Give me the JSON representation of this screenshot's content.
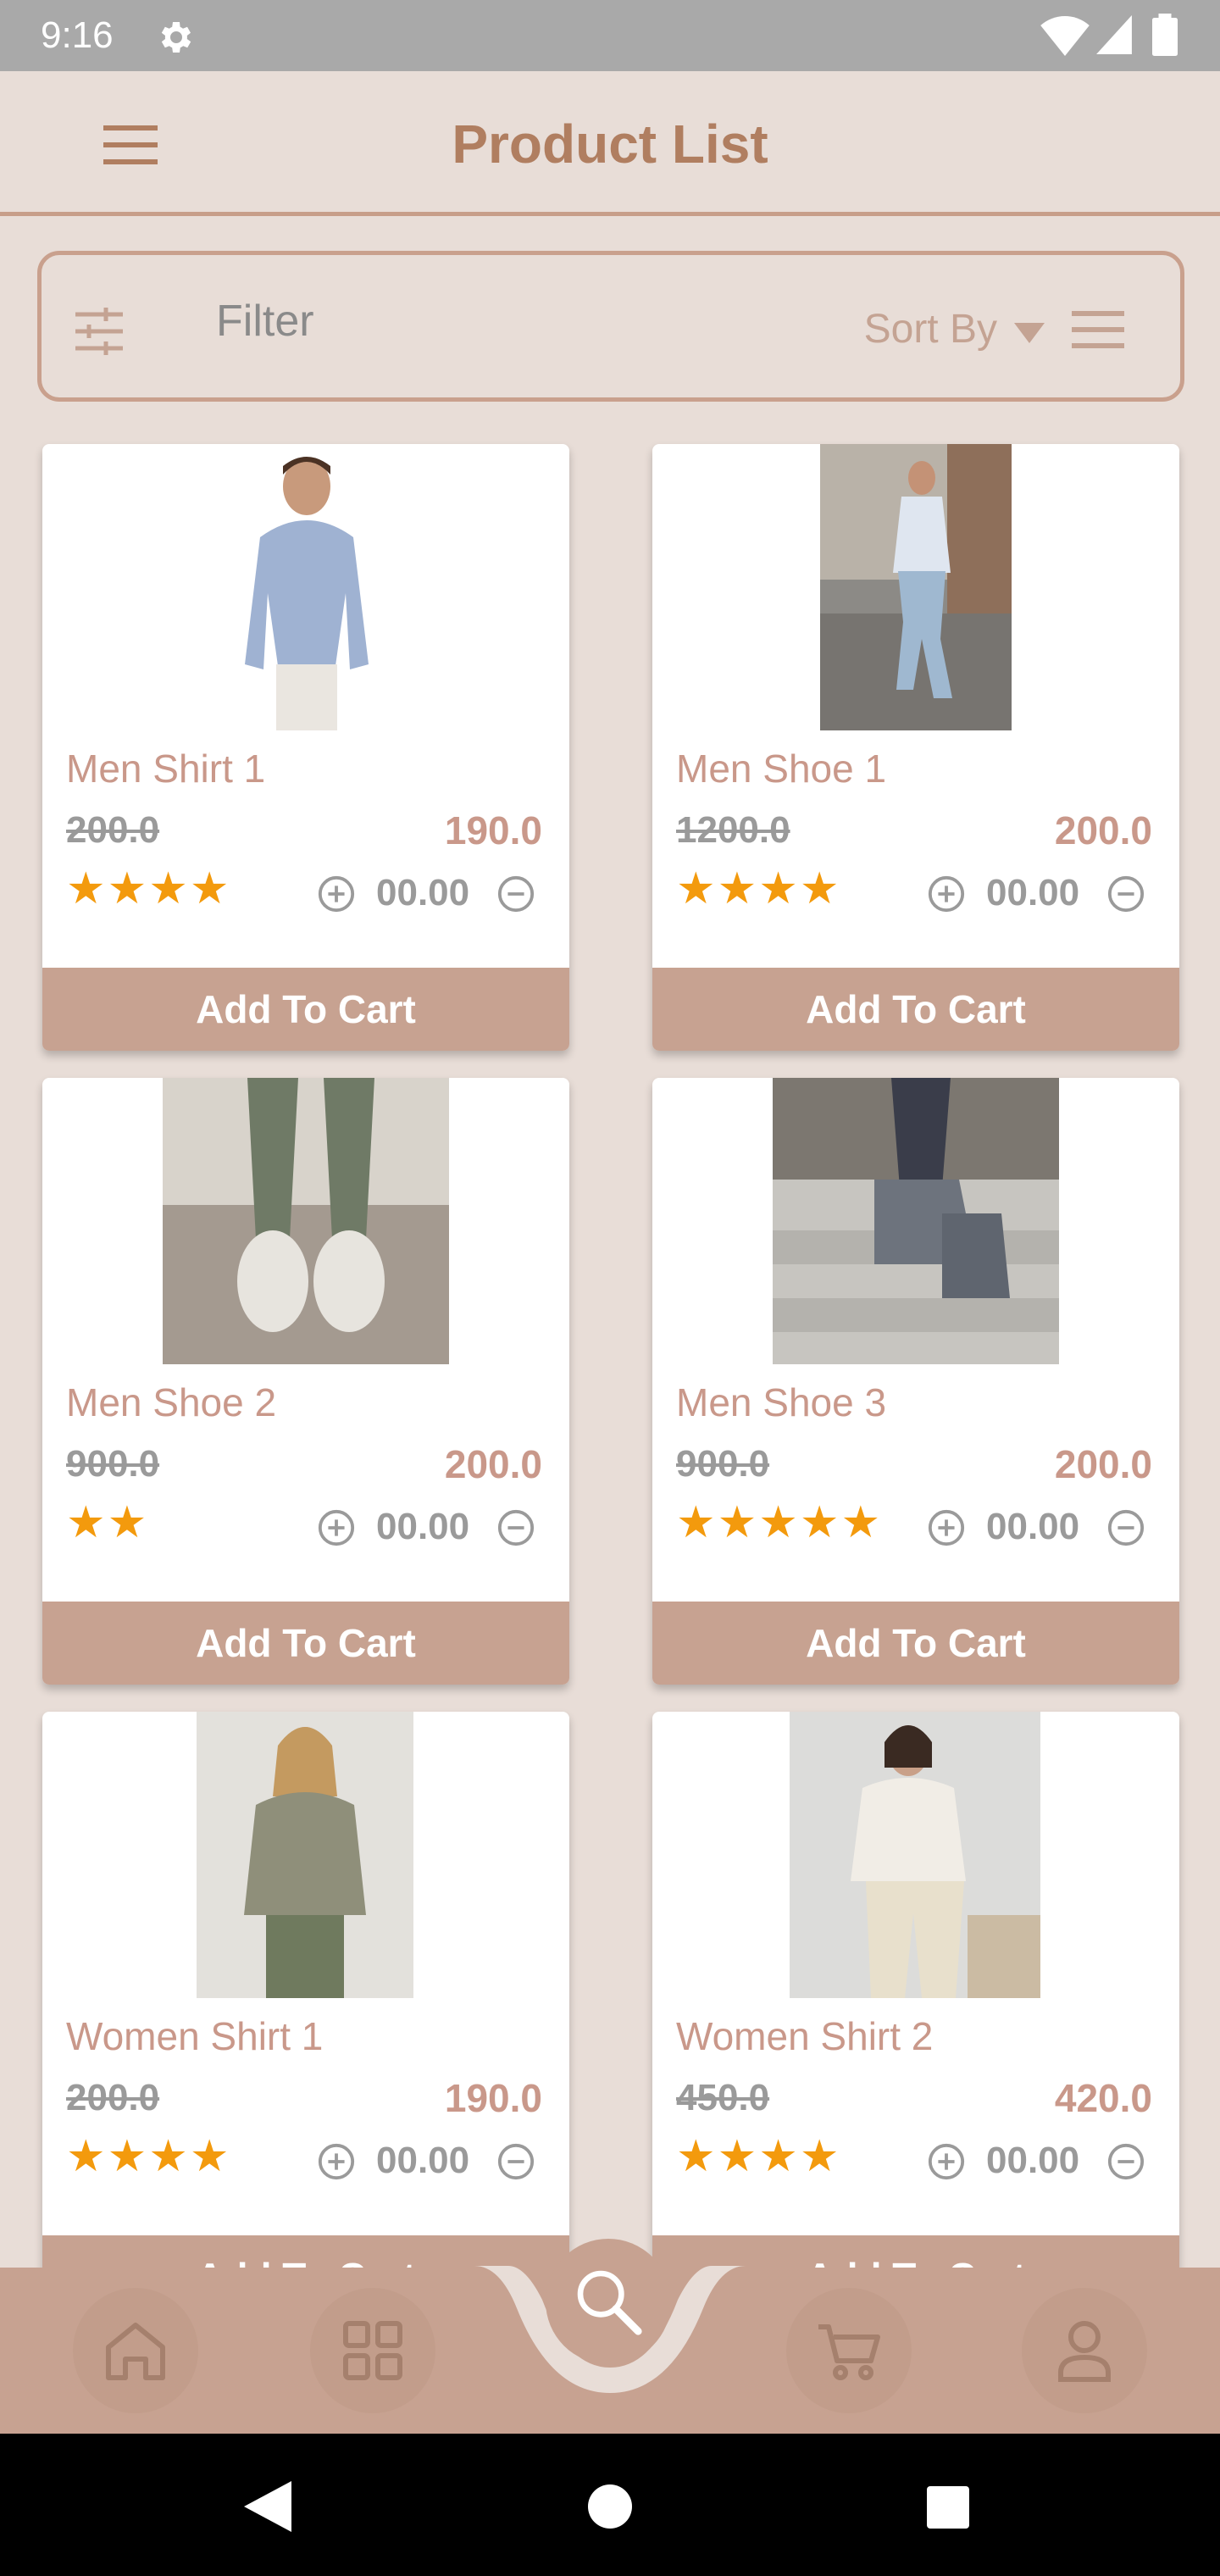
{
  "status_bar": {
    "time": "9:16"
  },
  "header": {
    "title": "Product List"
  },
  "filter_bar": {
    "filter_label": "Filter",
    "sort_label": "Sort By"
  },
  "colors": {
    "accent": "#c7a291",
    "title": "#b07e60",
    "star": "#f39a0d",
    "background": "#e8ddd7"
  },
  "products": [
    {
      "name": "Men Shirt 1",
      "old_price": "200.0",
      "new_price": "190.0",
      "rating": 4,
      "stars": "★★★★",
      "quantity": "00.00",
      "button": "Add To Cart"
    },
    {
      "name": "Men Shoe 1",
      "old_price": "1200.0",
      "new_price": "200.0",
      "rating": 4,
      "stars": "★★★★",
      "quantity": "00.00",
      "button": "Add To Cart"
    },
    {
      "name": "Men Shoe 2",
      "old_price": "900.0",
      "new_price": "200.0",
      "rating": 2,
      "stars": "★★",
      "quantity": "00.00",
      "button": "Add To Cart"
    },
    {
      "name": "Men Shoe 3",
      "old_price": "900.0",
      "new_price": "200.0",
      "rating": 5,
      "stars": "★★★★★",
      "quantity": "00.00",
      "button": "Add To Cart"
    },
    {
      "name": "Women Shirt 1",
      "old_price": "200.0",
      "new_price": "190.0",
      "rating": 4,
      "stars": "★★★★",
      "quantity": "00.00",
      "button": "Add To Cart"
    },
    {
      "name": "Women Shirt 2",
      "old_price": "450.0",
      "new_price": "420.0",
      "rating": 4,
      "stars": "★★★★",
      "quantity": "00.00",
      "button": "Add To Cart"
    }
  ],
  "bottom_nav": {
    "items": [
      "home-icon",
      "grid-icon",
      "search-icon",
      "cart-icon",
      "profile-icon"
    ]
  }
}
